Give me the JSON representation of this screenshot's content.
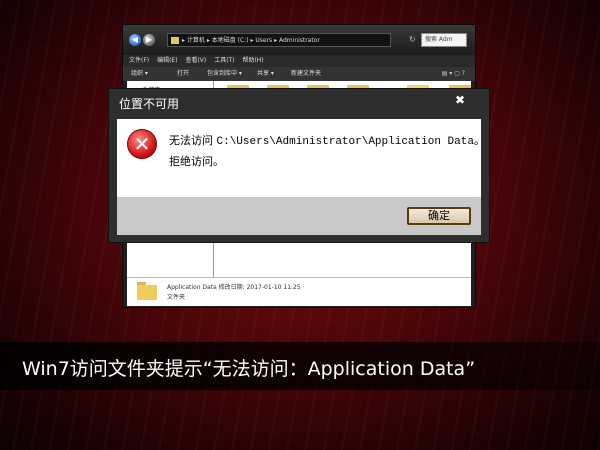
{
  "explorer": {
    "address_path": "▸ 计算机 ▸ 本地磁盘 (C:) ▸ Users ▸ Administrator",
    "search_placeholder": "搜索 Adm",
    "refresh_glyph": "↻",
    "menu": [
      "文件(F)",
      "编辑(E)",
      "查看(V)",
      "工具(T)",
      "帮助(H)"
    ],
    "toolbar": {
      "organize": "组织 ▾",
      "open": "打开",
      "include": "包含到库中 ▾",
      "share": "共享 ▾",
      "new_folder": "新建文件夹"
    },
    "nav_fav": "☆ 收藏夹",
    "details": {
      "name_line": "Application Data  修改日期: 2017-01-10 11:25",
      "type": "文件夹"
    },
    "icons": {
      "back": "arrow-left-icon",
      "forward": "arrow-right-icon",
      "folder": "folder-icon",
      "views": "view-options-icon"
    }
  },
  "dialog": {
    "title": "位置不可用",
    "close_glyph": "✖",
    "message_prefix": "无法访问 ",
    "message_path": "C:\\Users\\Administrator\\Application Data。",
    "message_line2": "拒绝访问。",
    "ok_label": "确定",
    "icon": "error-x-icon",
    "error_glyph": "✕"
  },
  "caption": "Win7访问文件夹提示“无法访问：Application Data”",
  "colors": {
    "background": "#4a0508",
    "dialog_title_bar": "#2e2e2e",
    "error_red": "#d01818"
  }
}
